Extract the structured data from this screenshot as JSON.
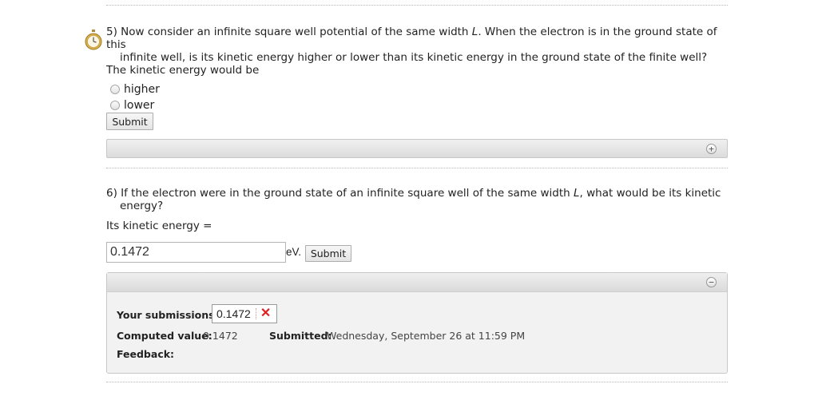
{
  "q5": {
    "number_text": "5) Now consider an infinite square well potential of the same width ",
    "L": "L",
    "text_after_L": ". When the electron is in the ground state of this",
    "line2": "infinite well, is its kinetic energy higher or lower than its kinetic energy in the ground state of the finite well?",
    "prompt": "The kinetic energy would be",
    "options": [
      "higher",
      "lower"
    ],
    "submit_label": "Submit"
  },
  "q6": {
    "text_before_L": "6) If the electron were in the ground state of an infinite square well of the same width ",
    "L": "L",
    "text_after_L": ", what would be its kinetic",
    "line2": "energy?",
    "prompt": "Its kinetic energy =",
    "input_value": "0.1472",
    "unit": "eV.",
    "submit_label": "Submit",
    "submissions_label": "Your submissions:",
    "submission_value": "0.1472",
    "computed_label": "Computed value:",
    "computed_value": "0.1472",
    "submitted_label": "Submitted:",
    "submitted_value": "Wednesday, September 26 at 11:59 PM",
    "feedback_label": "Feedback:"
  },
  "icons": {
    "expand": "plus-circle-icon",
    "collapse": "minus-circle-icon",
    "timer": "stopwatch-icon",
    "wrong": "x-mark-icon"
  },
  "colors": {
    "wrong": "#e02020"
  }
}
